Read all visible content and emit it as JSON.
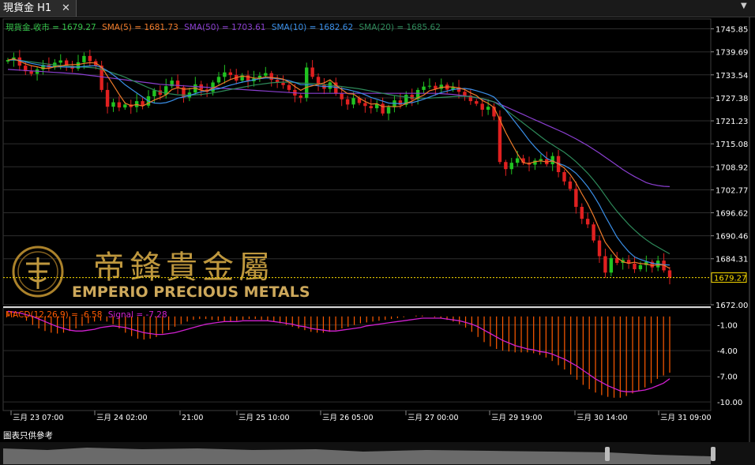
{
  "tab": {
    "label": "現貨金 H1",
    "close": "✕"
  },
  "indicators": {
    "close": "現貨金.收市 = 1679.27",
    "sma5": "SMA(5) = 1681.73",
    "sma50": "SMA(50) = 1703.61",
    "sma10": "SMA(10) = 1682.62",
    "sma20": "SMA(20) = 1685.62"
  },
  "macd_label": {
    "macd": "MACD(12,26,9) = -6.58",
    "signal": "Signal = -7.28"
  },
  "watermark": {
    "cn": "帝鋒貴金屬",
    "en": "EMPERIO PRECIOUS METALS"
  },
  "footer": {
    "disclaimer": "圖表只供參考"
  },
  "colors": {
    "close": "#35c24a",
    "sma5": "#f07b2a",
    "sma10": "#3a8fe8",
    "sma20": "#2e8a5a",
    "sma50": "#8a3fd0",
    "up": "#21c321",
    "down": "#e02020",
    "macd": "#ff5a00",
    "signal": "#d020d0",
    "price_marker": "#ffe000"
  },
  "chart_data": [
    {
      "type": "candlestick",
      "timeframe": "H1",
      "ylim": [
        1672.0,
        1748.5
      ],
      "yticks": [
        "1745.85",
        "1739.69",
        "1733.54",
        "1727.38",
        "1721.23",
        "1715.08",
        "1708.92",
        "1702.77",
        "1696.62",
        "1690.46",
        "1684.31",
        "1672.00"
      ],
      "last_price": "1679.27",
      "xticks": [
        "三月 23 07:00",
        "三月 24 02:00",
        "21:00",
        "三月 25 10:00",
        "三月 26 05:00",
        "三月 27 00:00",
        "三月 29 19:00",
        "三月 30 14:00",
        "三月 31 09:00"
      ],
      "closes": [
        1737.5,
        1738.2,
        1736.0,
        1734.5,
        1733.8,
        1735.0,
        1736.2,
        1735.5,
        1736.8,
        1737.4,
        1736.0,
        1735.2,
        1736.9,
        1738.6,
        1737.2,
        1736.0,
        1729.5,
        1725.0,
        1726.2,
        1724.8,
        1725.6,
        1724.9,
        1726.5,
        1725.3,
        1727.8,
        1729.4,
        1728.2,
        1730.5,
        1732.0,
        1730.2,
        1727.5,
        1728.8,
        1731.0,
        1729.6,
        1729.0,
        1731.5,
        1733.0,
        1734.2,
        1733.5,
        1732.0,
        1733.4,
        1731.8,
        1732.6,
        1733.3,
        1734.0,
        1732.2,
        1731.4,
        1730.8,
        1729.5,
        1728.0,
        1727.4,
        1735.5,
        1733.0,
        1731.0,
        1729.8,
        1731.5,
        1728.5,
        1727.0,
        1725.6,
        1727.3,
        1726.0,
        1725.2,
        1724.6,
        1725.8,
        1723.2,
        1724.9,
        1726.7,
        1725.5,
        1728.2,
        1727.0,
        1729.5,
        1730.4,
        1730.6,
        1729.8,
        1730.9,
        1729.6,
        1730.2,
        1729.0,
        1728.0,
        1726.5,
        1725.8,
        1724.2,
        1725.0,
        1722.4,
        1710.2,
        1708.3,
        1710.0,
        1711.2,
        1710.0,
        1709.5,
        1710.6,
        1711.0,
        1709.6,
        1711.8,
        1707.5,
        1705.0,
        1703.0,
        1698.2,
        1695.0,
        1693.5,
        1689.2,
        1685.0,
        1680.6,
        1684.5,
        1683.2,
        1684.0,
        1683.0,
        1681.5,
        1682.6,
        1683.5,
        1682.0,
        1683.8,
        1681.2,
        1679.27
      ],
      "sma5": [
        1737.5,
        1737.8,
        1737.2,
        1736.5,
        1736.0,
        1735.7,
        1735.3,
        1735.3,
        1735.7,
        1735.9,
        1736.2,
        1736.3,
        1736.3,
        1736.6,
        1736.8,
        1736.7,
        1735.6,
        1733.2,
        1730.8,
        1728.3,
        1726.0,
        1725.3,
        1725.6,
        1725.2,
        1726.0,
        1726.8,
        1727.4,
        1728.2,
        1729.6,
        1730.1,
        1729.7,
        1729.8,
        1730.0,
        1729.4,
        1729.2,
        1730.0,
        1730.7,
        1731.5,
        1732.3,
        1732.8,
        1733.2,
        1733.0,
        1732.7,
        1732.6,
        1733.0,
        1732.8,
        1732.7,
        1732.4,
        1731.6,
        1730.4,
        1729.4,
        1730.2,
        1730.6,
        1731.0,
        1731.4,
        1732.2,
        1730.8,
        1729.6,
        1728.5,
        1728.4,
        1727.3,
        1726.4,
        1725.7,
        1725.8,
        1725.0,
        1725.1,
        1725.0,
        1725.1,
        1725.9,
        1726.5,
        1727.4,
        1728.1,
        1729.3,
        1729.7,
        1730.2,
        1730.3,
        1730.3,
        1730.0,
        1729.6,
        1728.7,
        1728.0,
        1726.7,
        1725.9,
        1724.8,
        1721.5,
        1718.1,
        1715.2,
        1712.4,
        1710.0,
        1709.8,
        1710.3,
        1710.5,
        1710.2,
        1710.5,
        1709.7,
        1708.6,
        1706.9,
        1704.6,
        1701.7,
        1699.0,
        1695.8,
        1692.2,
        1688.7,
        1686.6,
        1684.6,
        1683.5,
        1683.1,
        1683.4,
        1683.0,
        1682.9,
        1682.5,
        1682.7,
        1682.6,
        1681.73
      ],
      "sma10": [
        1737.5,
        1737.6,
        1737.4,
        1737.0,
        1736.6,
        1736.3,
        1736.0,
        1735.8,
        1735.7,
        1735.7,
        1735.6,
        1735.6,
        1735.6,
        1735.8,
        1735.9,
        1736.0,
        1735.5,
        1734.6,
        1733.5,
        1732.3,
        1730.9,
        1729.8,
        1728.7,
        1727.6,
        1726.5,
        1726.0,
        1725.9,
        1726.1,
        1726.6,
        1727.3,
        1727.6,
        1728.0,
        1728.5,
        1729.0,
        1729.2,
        1729.6,
        1729.8,
        1730.3,
        1730.8,
        1731.2,
        1731.6,
        1731.9,
        1732.2,
        1732.5,
        1732.7,
        1732.7,
        1732.5,
        1732.3,
        1732.0,
        1731.5,
        1730.9,
        1730.9,
        1730.8,
        1730.6,
        1730.4,
        1730.4,
        1730.2,
        1729.9,
        1729.6,
        1729.2,
        1728.8,
        1728.2,
        1727.5,
        1727.0,
        1726.5,
        1726.0,
        1725.9,
        1725.8,
        1726.0,
        1726.1,
        1726.5,
        1727.0,
        1727.6,
        1728.2,
        1728.8,
        1729.2,
        1729.6,
        1729.8,
        1729.9,
        1729.7,
        1729.3,
        1728.8,
        1728.3,
        1727.6,
        1726.0,
        1724.1,
        1722.1,
        1720.1,
        1718.1,
        1716.0,
        1714.2,
        1712.6,
        1711.2,
        1710.4,
        1709.8,
        1709.3,
        1708.4,
        1707.2,
        1705.5,
        1703.6,
        1701.3,
        1698.7,
        1695.7,
        1692.9,
        1690.1,
        1688.0,
        1686.2,
        1684.8,
        1684.1,
        1683.6,
        1683.1,
        1682.9,
        1682.7,
        1682.62
      ],
      "sma20": [
        1737.5,
        1737.5,
        1737.4,
        1737.2,
        1737.0,
        1736.8,
        1736.6,
        1736.4,
        1736.2,
        1736.0,
        1735.9,
        1735.8,
        1735.7,
        1735.6,
        1735.5,
        1735.4,
        1735.0,
        1734.5,
        1734.0,
        1733.5,
        1732.9,
        1732.2,
        1731.5,
        1730.8,
        1730.1,
        1729.5,
        1729.0,
        1728.6,
        1728.4,
        1728.2,
        1728.1,
        1728.1,
        1728.2,
        1728.3,
        1728.5,
        1728.7,
        1729.0,
        1729.3,
        1729.6,
        1729.9,
        1730.2,
        1730.5,
        1730.8,
        1731.0,
        1731.2,
        1731.4,
        1731.5,
        1731.6,
        1731.6,
        1731.5,
        1731.3,
        1731.3,
        1731.2,
        1731.1,
        1730.9,
        1730.8,
        1730.6,
        1730.4,
        1730.2,
        1730.0,
        1729.8,
        1729.5,
        1729.2,
        1728.9,
        1728.6,
        1728.3,
        1728.0,
        1727.8,
        1727.6,
        1727.4,
        1727.3,
        1727.3,
        1727.3,
        1727.4,
        1727.5,
        1727.6,
        1727.7,
        1727.8,
        1727.8,
        1727.7,
        1727.5,
        1727.2,
        1726.8,
        1726.3,
        1725.3,
        1724.2,
        1723.0,
        1721.8,
        1720.6,
        1719.4,
        1718.2,
        1717.0,
        1715.8,
        1714.8,
        1713.8,
        1712.8,
        1711.6,
        1710.3,
        1708.8,
        1707.2,
        1705.4,
        1703.4,
        1701.2,
        1699.0,
        1697.0,
        1695.2,
        1693.5,
        1692.0,
        1690.6,
        1689.4,
        1688.3,
        1687.4,
        1686.5,
        1685.62
      ],
      "sma50": [
        1735.0,
        1734.9,
        1734.8,
        1734.7,
        1734.6,
        1734.5,
        1734.4,
        1734.3,
        1734.2,
        1734.1,
        1734.0,
        1733.9,
        1733.8,
        1733.6,
        1733.4,
        1733.2,
        1733.0,
        1732.8,
        1732.6,
        1732.4,
        1732.2,
        1732.0,
        1731.8,
        1731.6,
        1731.4,
        1731.2,
        1731.0,
        1730.9,
        1730.8,
        1730.7,
        1730.6,
        1730.5,
        1730.4,
        1730.3,
        1730.2,
        1730.1,
        1730.0,
        1729.9,
        1729.8,
        1729.7,
        1729.6,
        1729.5,
        1729.4,
        1729.3,
        1729.2,
        1729.1,
        1729.0,
        1728.9,
        1728.8,
        1728.7,
        1728.6,
        1728.6,
        1728.6,
        1728.6,
        1728.6,
        1728.6,
        1728.6,
        1728.6,
        1728.6,
        1728.6,
        1728.6,
        1728.6,
        1728.6,
        1728.6,
        1728.6,
        1728.6,
        1728.6,
        1728.6,
        1728.6,
        1728.6,
        1728.6,
        1728.6,
        1728.6,
        1728.6,
        1728.5,
        1728.4,
        1728.3,
        1728.1,
        1727.9,
        1727.7,
        1727.4,
        1727.1,
        1726.7,
        1726.3,
        1725.7,
        1725.0,
        1724.3,
        1723.6,
        1722.9,
        1722.2,
        1721.5,
        1720.8,
        1720.1,
        1719.4,
        1718.7,
        1718.0,
        1717.2,
        1716.4,
        1715.5,
        1714.6,
        1713.6,
        1712.6,
        1711.5,
        1710.4,
        1709.3,
        1708.2,
        1707.2,
        1706.3,
        1705.5,
        1704.7,
        1704.2,
        1703.9,
        1703.7,
        1703.61
      ]
    },
    {
      "type": "macd",
      "params": "12,26,9",
      "ylim": [
        -11.0,
        1.0
      ],
      "yticks": [
        "-1.00",
        "-4.00",
        "-7.00",
        "-10.00"
      ],
      "macd": [
        0.6,
        0.4,
        0.0,
        -0.5,
        -1.0,
        -1.4,
        -1.7,
        -1.9,
        -2.0,
        -1.9,
        -1.7,
        -1.4,
        -1.1,
        -0.8,
        -0.6,
        -0.5,
        -0.6,
        -0.9,
        -1.4,
        -1.9,
        -2.3,
        -2.6,
        -2.7,
        -2.6,
        -2.4,
        -2.0,
        -1.6,
        -1.2,
        -0.9,
        -0.6,
        -0.4,
        -0.3,
        -0.3,
        -0.4,
        -0.5,
        -0.6,
        -0.6,
        -0.5,
        -0.4,
        -0.3,
        -0.3,
        -0.4,
        -0.5,
        -0.6,
        -0.8,
        -1.0,
        -1.2,
        -1.4,
        -1.6,
        -1.8,
        -1.9,
        -1.9,
        -1.8,
        -1.6,
        -1.4,
        -1.2,
        -1.0,
        -0.8,
        -0.7,
        -0.6,
        -0.5,
        -0.4,
        -0.3,
        -0.2,
        -0.1,
        0.0,
        0.1,
        0.1,
        0.0,
        -0.1,
        -0.2,
        -0.4,
        -0.6,
        -0.9,
        -1.3,
        -1.8,
        -2.4,
        -3.0,
        -3.5,
        -3.8,
        -4.0,
        -4.1,
        -4.2,
        -4.2,
        -4.2,
        -4.3,
        -4.5,
        -4.8,
        -5.2,
        -5.7,
        -6.2,
        -6.8,
        -7.4,
        -8.0,
        -8.5,
        -8.9,
        -9.2,
        -9.4,
        -9.5,
        -9.5,
        -9.3,
        -9.0,
        -8.7,
        -8.3,
        -7.8,
        -7.3,
        -6.9,
        -6.58
      ],
      "signal": [
        0.6,
        0.5,
        0.4,
        0.2,
        0.0,
        -0.3,
        -0.6,
        -0.9,
        -1.2,
        -1.4,
        -1.6,
        -1.7,
        -1.7,
        -1.6,
        -1.5,
        -1.3,
        -1.2,
        -1.1,
        -1.2,
        -1.3,
        -1.5,
        -1.7,
        -1.9,
        -2.0,
        -2.1,
        -2.1,
        -2.0,
        -1.9,
        -1.7,
        -1.5,
        -1.3,
        -1.1,
        -0.9,
        -0.8,
        -0.7,
        -0.6,
        -0.6,
        -0.6,
        -0.5,
        -0.5,
        -0.5,
        -0.5,
        -0.5,
        -0.6,
        -0.7,
        -0.8,
        -0.9,
        -1.1,
        -1.2,
        -1.4,
        -1.5,
        -1.6,
        -1.7,
        -1.7,
        -1.6,
        -1.5,
        -1.4,
        -1.3,
        -1.1,
        -1.0,
        -0.9,
        -0.8,
        -0.7,
        -0.6,
        -0.5,
        -0.4,
        -0.3,
        -0.2,
        -0.2,
        -0.2,
        -0.2,
        -0.3,
        -0.4,
        -0.5,
        -0.7,
        -0.9,
        -1.2,
        -1.6,
        -2.0,
        -2.4,
        -2.8,
        -3.1,
        -3.4,
        -3.6,
        -3.8,
        -3.9,
        -4.1,
        -4.2,
        -4.4,
        -4.7,
        -5.0,
        -5.4,
        -5.8,
        -6.3,
        -6.8,
        -7.3,
        -7.7,
        -8.1,
        -8.4,
        -8.7,
        -8.8,
        -8.8,
        -8.7,
        -8.6,
        -8.4,
        -8.1,
        -7.8,
        -7.28
      ]
    }
  ]
}
